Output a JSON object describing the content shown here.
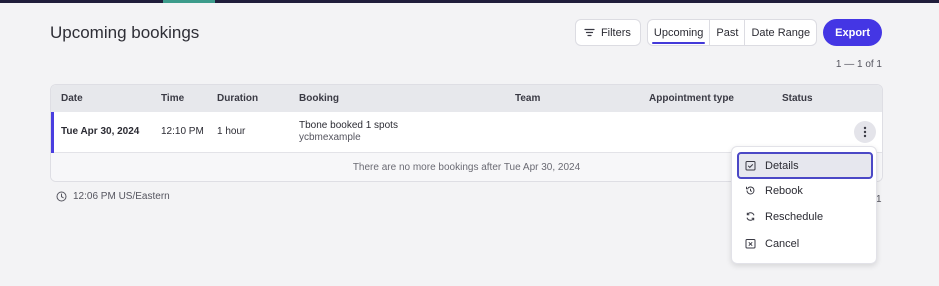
{
  "header": {
    "title": "Upcoming bookings",
    "filters_label": "Filters",
    "tabs": [
      {
        "label": "Upcoming",
        "active": true
      },
      {
        "label": "Past",
        "active": false
      },
      {
        "label": "Date Range",
        "active": false
      }
    ],
    "export_label": "Export"
  },
  "pagination": "1 — 1 of 1",
  "table": {
    "columns": [
      "Date",
      "Time",
      "Duration",
      "Booking",
      "Team",
      "Appointment type",
      "Status"
    ],
    "rows": [
      {
        "date": "Tue Apr 30, 2024",
        "time": "12:10 PM",
        "duration": "1 hour",
        "booking_title": "Tbone booked 1 spots",
        "booking_sub": "ycbmexample",
        "team": "",
        "appointment_type": "",
        "status": ""
      }
    ],
    "footer": "There are no more bookings after Tue Apr 30, 2024"
  },
  "timezone": "12:06 PM US/Eastern",
  "stray_char": "1",
  "menu": {
    "items": [
      {
        "label": "Details",
        "icon": "calendar-check-icon",
        "active": true
      },
      {
        "label": "Rebook",
        "icon": "history-icon",
        "active": false
      },
      {
        "label": "Reschedule",
        "icon": "refresh-icon",
        "active": false
      },
      {
        "label": "Cancel",
        "icon": "calendar-x-icon",
        "active": false
      }
    ]
  },
  "colors": {
    "accent": "#4436e4",
    "topbar": "#1f1d3b",
    "topbar_accent": "#3c9b8b",
    "row_marker": "#4a3ee0"
  }
}
